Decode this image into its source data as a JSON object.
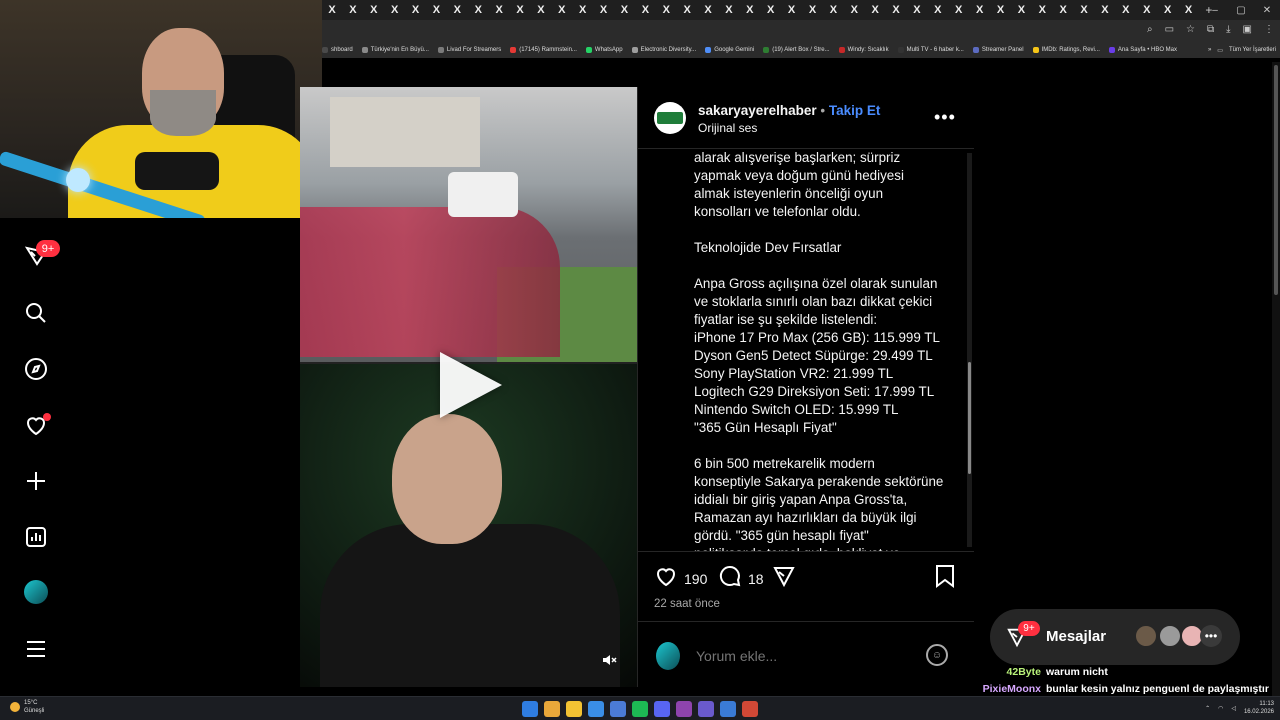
{
  "browser": {
    "tab_labels": [
      "X",
      "X",
      "X",
      "X",
      "X",
      "X",
      "X",
      "X",
      "X",
      "X",
      "X",
      "X",
      "X",
      "X",
      "X",
      "X",
      "X",
      "X",
      "X",
      "X",
      "X",
      "X",
      "X",
      "X",
      "X",
      "X",
      "X",
      "X",
      "X",
      "X",
      "X",
      "X",
      "X",
      "X",
      "X",
      "X",
      "X",
      "X",
      "X",
      "X",
      "X",
      "X"
    ],
    "new_tab": "+",
    "window_controls": [
      "–",
      "▢",
      "✕"
    ],
    "bookmarks": [
      {
        "label": "shboard",
        "color": "#4a4a4a"
      },
      {
        "label": "Türkiye'nin En Büyü...",
        "color": "#8a8a8a"
      },
      {
        "label": "Livad For Streamers",
        "color": "#7a7a7a"
      },
      {
        "label": "(17145) Rammstein...",
        "color": "#e53935"
      },
      {
        "label": "WhatsApp",
        "color": "#25d366"
      },
      {
        "label": "Electronic Diversity...",
        "color": "#9e9e9e"
      },
      {
        "label": "Google Gemini",
        "color": "#4f8ef7"
      },
      {
        "label": "(19) Alert Box / Stre...",
        "color": "#2e7d32"
      },
      {
        "label": "Windy: Sıcaklık",
        "color": "#c62828"
      },
      {
        "label": "Multi TV - 6 haber k...",
        "color": "#333333"
      },
      {
        "label": "Streamer Panel",
        "color": "#5c6bc0"
      },
      {
        "label": "IMDb: Ratings, Revi...",
        "color": "#f5c518"
      },
      {
        "label": "Ana Sayfa • HBO Max",
        "color": "#6a3de8"
      }
    ],
    "bookmarks_overflow": "»",
    "all_bookmarks": "Tüm Yer İşaretleri"
  },
  "nav": {
    "notifications_badge": "9+",
    "icons": [
      "threads-icon",
      "search-icon",
      "compass-icon",
      "heart-icon",
      "plus-icon",
      "insights-icon",
      "avatar",
      "menu-icon"
    ]
  },
  "post": {
    "username": "sakaryayerelhaber",
    "separator": "•",
    "follow_label": "Takip Et",
    "audio_label": "Orijinal ses",
    "more": "•••",
    "caption": [
      "alarak alışverişe başlarken; sürpriz",
      "yapmak veya doğum günü hediyesi",
      "almak isteyenlerin önceliği oyun",
      "konsolları ve telefonlar oldu.",
      "",
      "Teknolojide Dev Fırsatlar",
      "",
      "Anpa Gross açılışına özel olarak sunulan",
      "ve stoklarla sınırlı olan bazı dikkat çekici",
      "fiyatlar ise şu şekilde listelendi:",
      "iPhone 17 Pro Max (256 GB): 115.999 TL",
      "Dyson Gen5 Detect Süpürge: 29.499 TL",
      "Sony PlayStation VR2: 21.999 TL",
      "Logitech G29 Direksiyon Seti: 17.999 TL",
      "Nintendo Switch OLED: 15.999 TL",
      "\"365 Gün Hesaplı Fiyat\"",
      "",
      "6 bin 500 metrekarelik modern",
      "konseptiyle Sakarya perakende sektörüne",
      "iddialı bir giriş yapan Anpa Gross'ta,",
      "Ramazan ayı hazırlıkları da büyük ilgi",
      "gördü. \"365 gün hesaplı fiyat\"",
      "politikasıyla temel gıda, bakliyat ve"
    ],
    "likes": "190",
    "comments": "18",
    "time_ago": "22 saat önce",
    "comment_placeholder": "Yorum ekle...",
    "emoji": "☺"
  },
  "messages": {
    "badge": "9+",
    "label": "Mesajlar",
    "more": "•••",
    "avatar_colors": [
      "#6b5a48",
      "#9a9a9a",
      "#e8b4b4"
    ]
  },
  "chat": [
    {
      "user": "42Byte",
      "user_color": "#b9f27a",
      "message": "warum nicht"
    },
    {
      "user": "PixieMoonx",
      "user_color": "#d7a8ff",
      "message": "bunlar kesin yalnız penguenl de paylaşmıştır storylerinde"
    }
  ],
  "taskbar": {
    "weather_temp": "15°C",
    "weather_desc": "Güneşli",
    "time": "11:13",
    "date": "16.02.2026",
    "app_colors": [
      "#2f7de1",
      "#eaa83a",
      "#f2c233",
      "#3a8ee6",
      "#4b7bd6",
      "#1db954",
      "#5865f2",
      "#8e44ad",
      "#6a5acd",
      "#3a7bd5",
      "#d14836"
    ]
  }
}
